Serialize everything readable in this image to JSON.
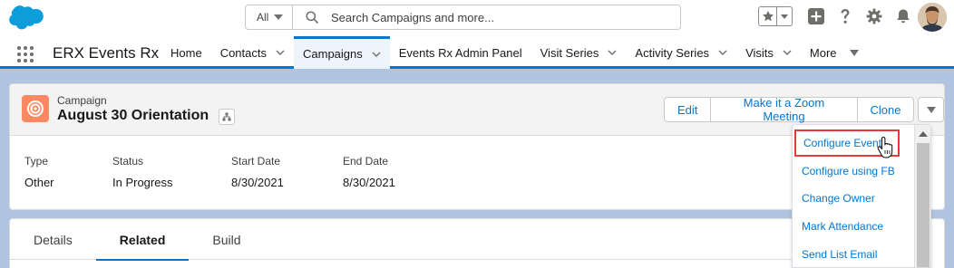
{
  "search": {
    "scope": "All",
    "placeholder": "Search Campaigns and more..."
  },
  "nav": {
    "app_name": "ERX Events Rx",
    "items": [
      {
        "label": "Home",
        "dropdown": false,
        "active": false
      },
      {
        "label": "Contacts",
        "dropdown": true,
        "active": false
      },
      {
        "label": "Campaigns",
        "dropdown": true,
        "active": true
      },
      {
        "label": "Events Rx Admin Panel",
        "dropdown": false,
        "active": false
      },
      {
        "label": "Visit Series",
        "dropdown": true,
        "active": false
      },
      {
        "label": "Activity Series",
        "dropdown": true,
        "active": false
      },
      {
        "label": "Visits",
        "dropdown": true,
        "active": false
      }
    ],
    "more_label": "More"
  },
  "record": {
    "object_type": "Campaign",
    "title": "August 30 Orientation",
    "actions": [
      "Edit",
      "Make it a Zoom Meeting",
      "Clone"
    ],
    "fields": [
      {
        "label": "Type",
        "value": "Other"
      },
      {
        "label": "Status",
        "value": "In Progress"
      },
      {
        "label": "Start Date",
        "value": "8/30/2021"
      },
      {
        "label": "End Date",
        "value": "8/30/2021"
      }
    ]
  },
  "tabs": [
    "Details",
    "Related",
    "Build"
  ],
  "active_tab": "Related",
  "menu": {
    "items": [
      "Configure Event",
      "Configure using FB",
      "Change Owner",
      "Mark Attendance",
      "Send List Email"
    ],
    "highlighted": "Configure Event"
  },
  "colors": {
    "brand": "#0176d3",
    "campaign_icon": "#f88962",
    "highlight_box": "#e5393a"
  }
}
